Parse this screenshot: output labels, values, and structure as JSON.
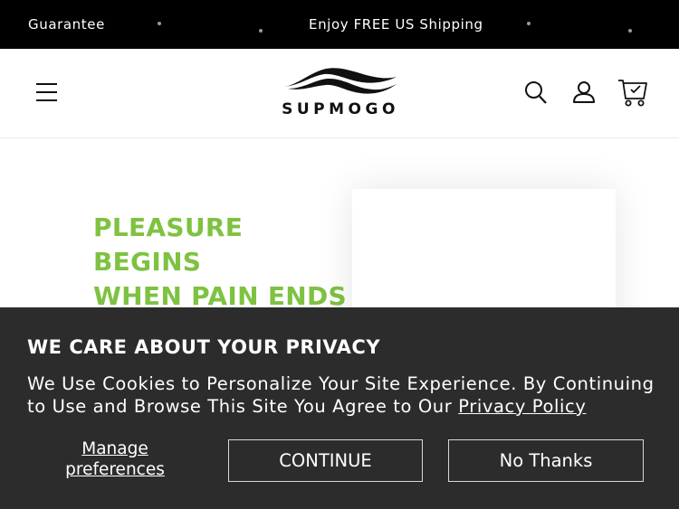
{
  "announcement": {
    "left_text": "Guarantee",
    "center_text": "Enjoy FREE US Shipping"
  },
  "header": {
    "menu_icon": "hamburger-icon",
    "logo_text": "SUPMOGO",
    "search_icon": "search-icon",
    "account_icon": "user-icon",
    "cart_icon": "cart-icon"
  },
  "hero": {
    "headline_lines": [
      "PLEASURE",
      "BEGINS",
      "WHEN PAIN ENDS"
    ]
  },
  "cookie_banner": {
    "title": "WE CARE ABOUT YOUR PRIVACY",
    "body_text": "We Use Cookies to Personalize Your Site Experience. By Continuing to Use and Browse This Site You Agree to Our",
    "policy_link": "Privacy Policy",
    "manage_label": "Manage preferences",
    "continue_label": "CONTINUE",
    "decline_label": "No Thanks"
  },
  "colors": {
    "headline": "#7ec241",
    "banner_bg": "#2c2c2c",
    "topbar_bg": "#000000"
  }
}
